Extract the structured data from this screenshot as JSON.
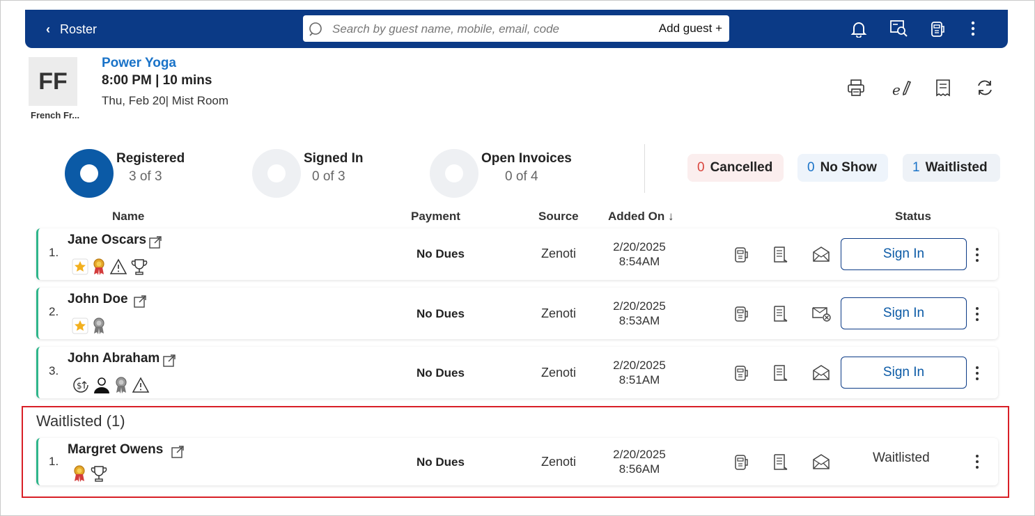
{
  "nav": {
    "back_label": "Roster"
  },
  "search": {
    "placeholder": "Search by guest name, mobile, email, code",
    "add_guest_label": "Add guest +"
  },
  "header": {
    "avatar_initials": "FF",
    "avatar_name": "French Fr...",
    "class_title": "Power Yoga",
    "time_line": "8:00 PM | 10 mins",
    "date_line": "Thu, Feb 20| Mist Room"
  },
  "stats": {
    "registered": {
      "label": "Registered",
      "value": "3 of 3"
    },
    "signed_in": {
      "label": "Signed In",
      "value": "0 of 3"
    },
    "open_invoices": {
      "label": "Open Invoices",
      "value": "0 of 4"
    }
  },
  "pills": {
    "cancelled": {
      "count": "0",
      "label": "Cancelled"
    },
    "no_show": {
      "count": "0",
      "label": "No Show"
    },
    "waitlisted": {
      "count": "1",
      "label": "Waitlisted"
    }
  },
  "columns": {
    "name": "Name",
    "payment": "Payment",
    "source": "Source",
    "added_on": "Added On ↓",
    "status": "Status"
  },
  "rows": [
    {
      "index": "1.",
      "name": "Jane Oscars",
      "payment": "No Dues",
      "source": "Zenoti",
      "date": "2/20/2025",
      "time": "8:54AM",
      "action": "Sign In"
    },
    {
      "index": "2.",
      "name": "John Doe",
      "payment": "No Dues",
      "source": "Zenoti",
      "date": "2/20/2025",
      "time": "8:53AM",
      "action": "Sign In"
    },
    {
      "index": "3.",
      "name": "John Abraham",
      "payment": "No Dues",
      "source": "Zenoti",
      "date": "2/20/2025",
      "time": "8:51AM",
      "action": "Sign In"
    }
  ],
  "waitlist": {
    "title": "Waitlisted (1)",
    "rows": [
      {
        "index": "1.",
        "name": "Margret Owens",
        "payment": "No Dues",
        "source": "Zenoti",
        "date": "2/20/2025",
        "time": "8:56AM",
        "status": "Waitlisted"
      }
    ]
  },
  "colors": {
    "nav": "#0b3a86",
    "accent": "#1a73c8",
    "row_border": "#2fb58a",
    "highlight_box": "#d81f26"
  }
}
